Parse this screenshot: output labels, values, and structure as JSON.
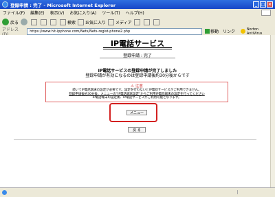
{
  "window": {
    "title": "登録申請 : 完了 - Microsoft Internet Explorer",
    "controls": [
      "_",
      "□",
      "×"
    ]
  },
  "menubar": {
    "items": [
      "ファイル(F)",
      "編集(E)",
      "表示(V)",
      "お気に入り(A)",
      "ツール(T)",
      "ヘルプ(H)"
    ]
  },
  "toolbar": {
    "back": "戻る",
    "search": "検索",
    "favorites": "お気に入り",
    "media": "メディア"
  },
  "address": {
    "label": "アドレス(D)",
    "url": "https://www.hit-ipphone.com/Nets/Nets-regist-phone2.php",
    "go": "移動",
    "links": "リンク",
    "norton": "Norton AntiVirus"
  },
  "page": {
    "site_title": "IP電話サービス",
    "subtitle": "登録申請 : 完了",
    "headline": "IP電話サービスの登録申請が完了しました",
    "line2": "登録申請が有効になるのは登録申請後約30分後からです",
    "notice": {
      "head": "注意",
      "line1": "続いてIP電話端末の設定が必要です。設定を行わないとIP電話サービスがご利用できません。",
      "line2": "登録申請後約30分後、メニューの\"IP電話端末設定\"からご利用IP電話端末の設定を行ってください",
      "line3": "IP電話端末の設定後、IP電話サービスがご利用可能となります。"
    },
    "menu_button": "メニュー",
    "back_button": "戻 る"
  }
}
